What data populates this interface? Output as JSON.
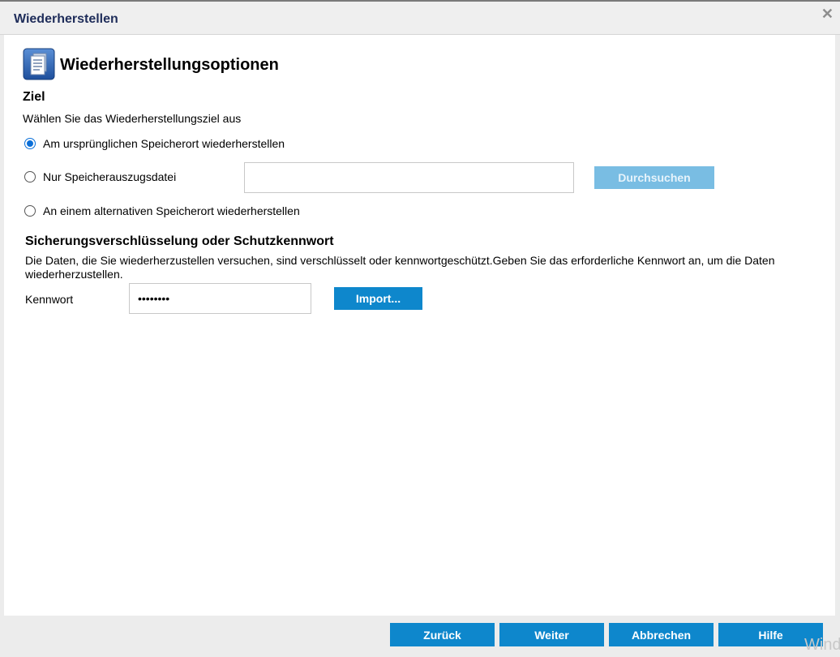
{
  "dialog": {
    "title": "Wiederherstellen",
    "close_glyph": "✕"
  },
  "header": {
    "icon": "document-stack-icon",
    "title": "Wiederherstellungsoptionen"
  },
  "ziel": {
    "heading": "Ziel",
    "description": "Wählen Sie das Wiederherstellungsziel aus",
    "options": [
      {
        "label": "Am ursprünglichen Speicherort wiederherstellen",
        "checked": true
      },
      {
        "label": "Nur Speicherauszugsdatei",
        "checked": false
      },
      {
        "label": "An einem alternativen Speicherort wiederherstellen",
        "checked": false
      }
    ],
    "dump_file_value": "",
    "browse_label": "Durchsuchen"
  },
  "encryption": {
    "heading": "Sicherungsverschlüsselung oder Schutzkennwort",
    "description": "Die Daten, die Sie wiederherzustellen versuchen, sind verschlüsselt oder kennwortgeschützt.Geben Sie das erforderliche Kennwort an, um die Daten wiederherzustellen.",
    "password_label": "Kennwort",
    "password_value": "••••••••",
    "import_label": "Import..."
  },
  "footer": {
    "back_label": "Zurück",
    "next_label": "Weiter",
    "cancel_label": "Abbrechen",
    "help_label": "Hilfe"
  },
  "watermark": "Windo",
  "colors": {
    "title_text": "#1f2d5a",
    "primary_button": "#0e87cc",
    "disabled_button": "#79bde3",
    "radio_checked": "#0a6fd8"
  }
}
